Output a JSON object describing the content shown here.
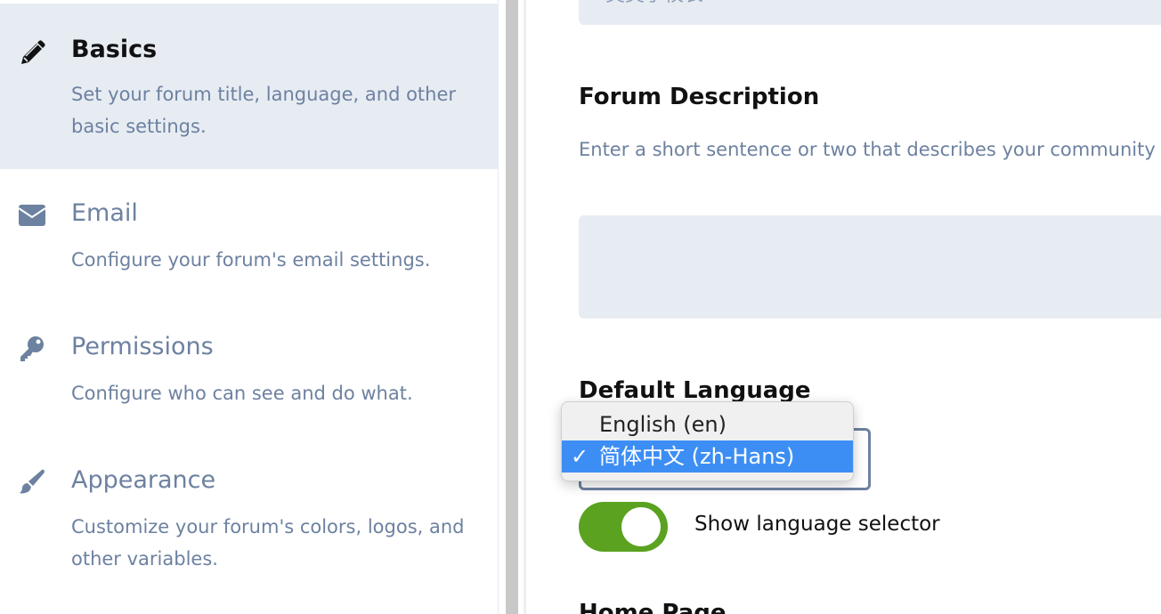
{
  "sidebar": {
    "items": [
      {
        "title": "Basics",
        "description": "Set your forum title, language, and other basic settings.",
        "icon": "pencil-icon"
      },
      {
        "title": "Email",
        "description": "Configure your forum's email settings.",
        "icon": "envelope-icon"
      },
      {
        "title": "Permissions",
        "description": "Configure who can see and do what.",
        "icon": "key-icon"
      },
      {
        "title": "Appearance",
        "description": "Customize your forum's colors, logos, and other variables.",
        "icon": "paintbrush-icon"
      }
    ]
  },
  "main": {
    "forum_title_value_partial": "类类子校长",
    "forum_description": {
      "label": "Forum Description",
      "help": "Enter a short sentence or two that describes your community and show up in search engines."
    },
    "default_language": {
      "label": "Default Language",
      "options": [
        "English (en)",
        "简体中文 (zh-Hans)"
      ],
      "selected": "简体中文 (zh-Hans)",
      "check_mark": "✓"
    },
    "show_language_selector": {
      "label": "Show language selector",
      "enabled": true
    },
    "home_page": {
      "label": "Home Page"
    }
  },
  "colors": {
    "active_bg": "#e7ecf3",
    "muted_text": "#6d81a0",
    "toggle_on": "#5aa220",
    "selection_blue": "#3d8ef4"
  }
}
